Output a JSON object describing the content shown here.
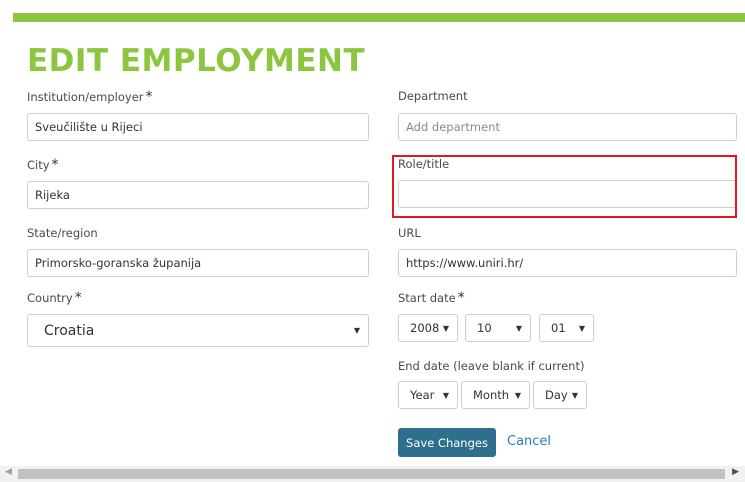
{
  "page": {
    "title": "EDIT EMPLOYMENT"
  },
  "form": {
    "institution": {
      "label": "Institution/employer",
      "required_mark": "*",
      "value": "Sveučilište u Rijeci"
    },
    "department": {
      "label": "Department",
      "placeholder": "Add department",
      "value": ""
    },
    "city": {
      "label": "City",
      "required_mark": "*",
      "value": "Rijeka"
    },
    "role": {
      "label": "Role/title",
      "value": ""
    },
    "state": {
      "label": "State/region",
      "value": "Primorsko-goranska županija"
    },
    "url": {
      "label": "URL",
      "value": "https://www.uniri.hr/"
    },
    "country": {
      "label": "Country",
      "required_mark": "*",
      "selected": "Croatia"
    },
    "start_date": {
      "label": "Start date",
      "required_mark": "*",
      "year": "2008",
      "month": "10",
      "day": "01"
    },
    "end_date": {
      "label": "End date (leave blank if current)",
      "year": "Year",
      "month": "Month",
      "day": "Day"
    }
  },
  "actions": {
    "save_label": "Save Changes",
    "cancel_label": "Cancel"
  },
  "icons": {
    "select_caret": "▼",
    "scroll_left": "◀",
    "scroll_right": "▶"
  },
  "colors": {
    "accent_green": "#8cc63f",
    "button_blue": "#2e6f8e",
    "link_blue": "#2c7bb6",
    "highlight_red": "#e0191f"
  }
}
